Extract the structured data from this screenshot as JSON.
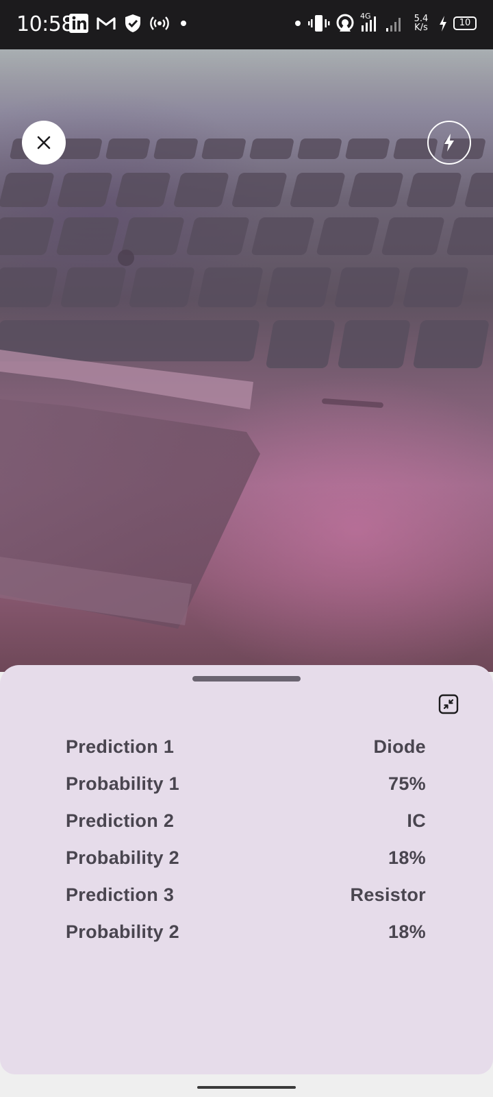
{
  "status_bar": {
    "time": "10:58",
    "net_speed_value": "5.4",
    "net_speed_unit": "K/s",
    "network_type": "4G",
    "battery": "10",
    "left_icons": [
      "linkedin-icon",
      "gmail-icon",
      "shield-icon",
      "hotspot-icon",
      "dot-icon"
    ],
    "right_icons": [
      "dot-icon",
      "vibrate-icon",
      "wifi-hotspot-icon",
      "signal-icon",
      "signal-icon",
      "charging-icon",
      "battery-icon"
    ]
  },
  "camera": {
    "close_icon": "close-icon",
    "flash_icon": "flash-icon"
  },
  "results": {
    "collapse_icon": "collapse-icon",
    "rows": [
      {
        "label": "Prediction 1",
        "value": "Diode"
      },
      {
        "label": "Probability 1",
        "value": "75%"
      },
      {
        "label": "Prediction 2",
        "value": "IC"
      },
      {
        "label": "Probability 2",
        "value": "18%"
      },
      {
        "label": "Prediction 3",
        "value": "Resistor"
      },
      {
        "label": "Probability 2",
        "value": "18%"
      }
    ]
  },
  "colors": {
    "sheet_background": "#e6dcea",
    "text": "#49454f",
    "status_bar": "#1c1b1d"
  }
}
